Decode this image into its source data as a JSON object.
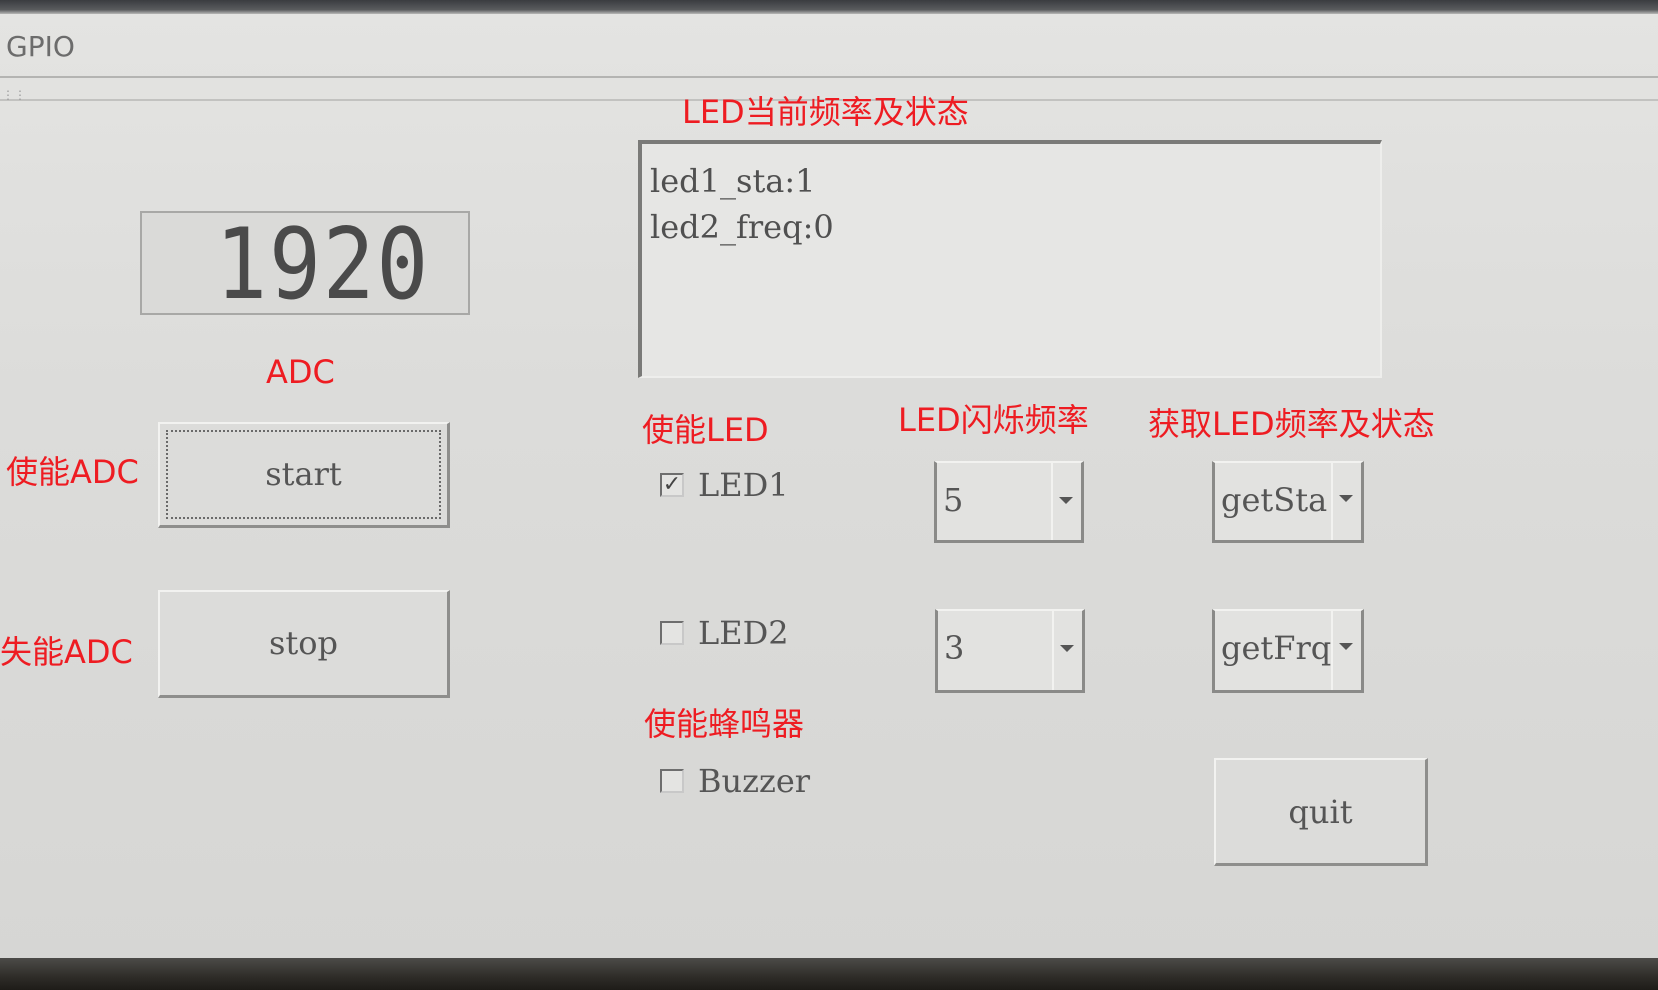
{
  "window": {
    "title": "GPIO"
  },
  "annotations": {
    "led_status_heading": "LED当前频率及状态",
    "adc_label": "ADC",
    "enable_adc": "使能ADC",
    "disable_adc": "失能ADC",
    "enable_led": "使能LED",
    "led_blink_freq": "LED闪烁频率",
    "get_led_freq_status": "获取LED频率及状态",
    "enable_buzzer": "使能蜂鸣器"
  },
  "adc": {
    "value": "1920"
  },
  "buttons": {
    "start": "start",
    "stop": "stop",
    "quit": "quit"
  },
  "status_text": {
    "line1": "led1_sta:1",
    "line2": "led2_freq:0"
  },
  "checkboxes": [
    {
      "label": "LED1",
      "checked": true
    },
    {
      "label": "LED2",
      "checked": false
    },
    {
      "label": "Buzzer",
      "checked": false
    }
  ],
  "freq_combos": [
    {
      "selected": "5"
    },
    {
      "selected": "3"
    }
  ],
  "query_combos": [
    {
      "selected": "getSta"
    },
    {
      "selected": "getFrq"
    }
  ],
  "colors": {
    "annotation": "#ee1c22",
    "background": "#dcdcda",
    "text": "#555555"
  }
}
